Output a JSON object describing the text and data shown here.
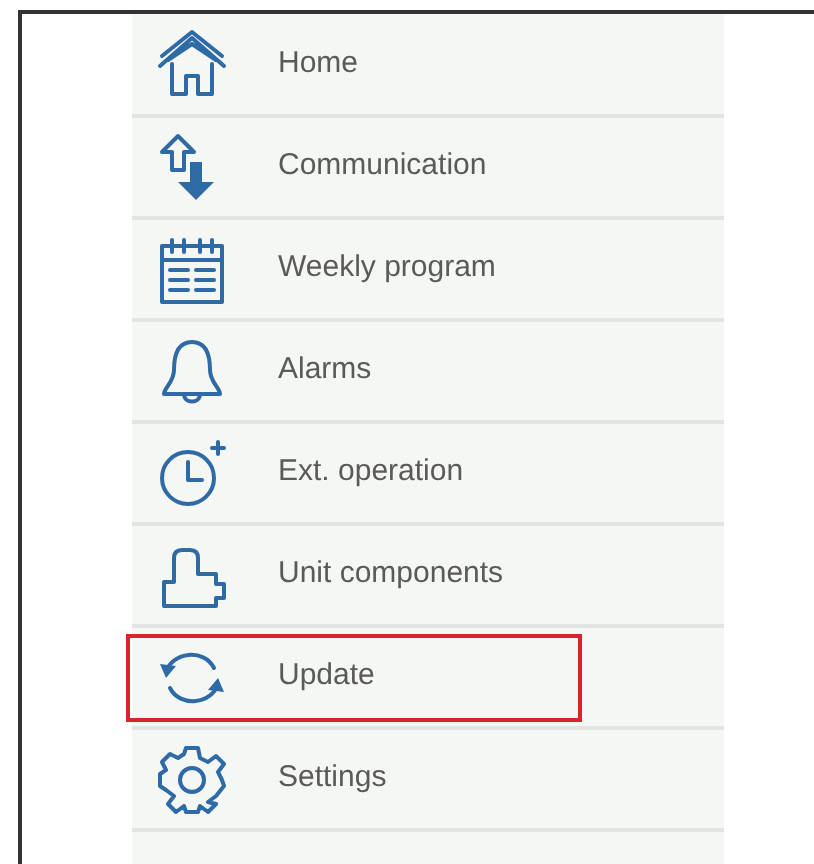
{
  "menu": {
    "items": [
      {
        "label": "Home",
        "highlighted": false
      },
      {
        "label": "Communication",
        "highlighted": false
      },
      {
        "label": "Weekly program",
        "highlighted": false
      },
      {
        "label": "Alarms",
        "highlighted": false
      },
      {
        "label": "Ext. operation",
        "highlighted": false
      },
      {
        "label": "Unit components",
        "highlighted": false
      },
      {
        "label": "Update",
        "highlighted": true
      },
      {
        "label": "Settings",
        "highlighted": false
      }
    ]
  }
}
